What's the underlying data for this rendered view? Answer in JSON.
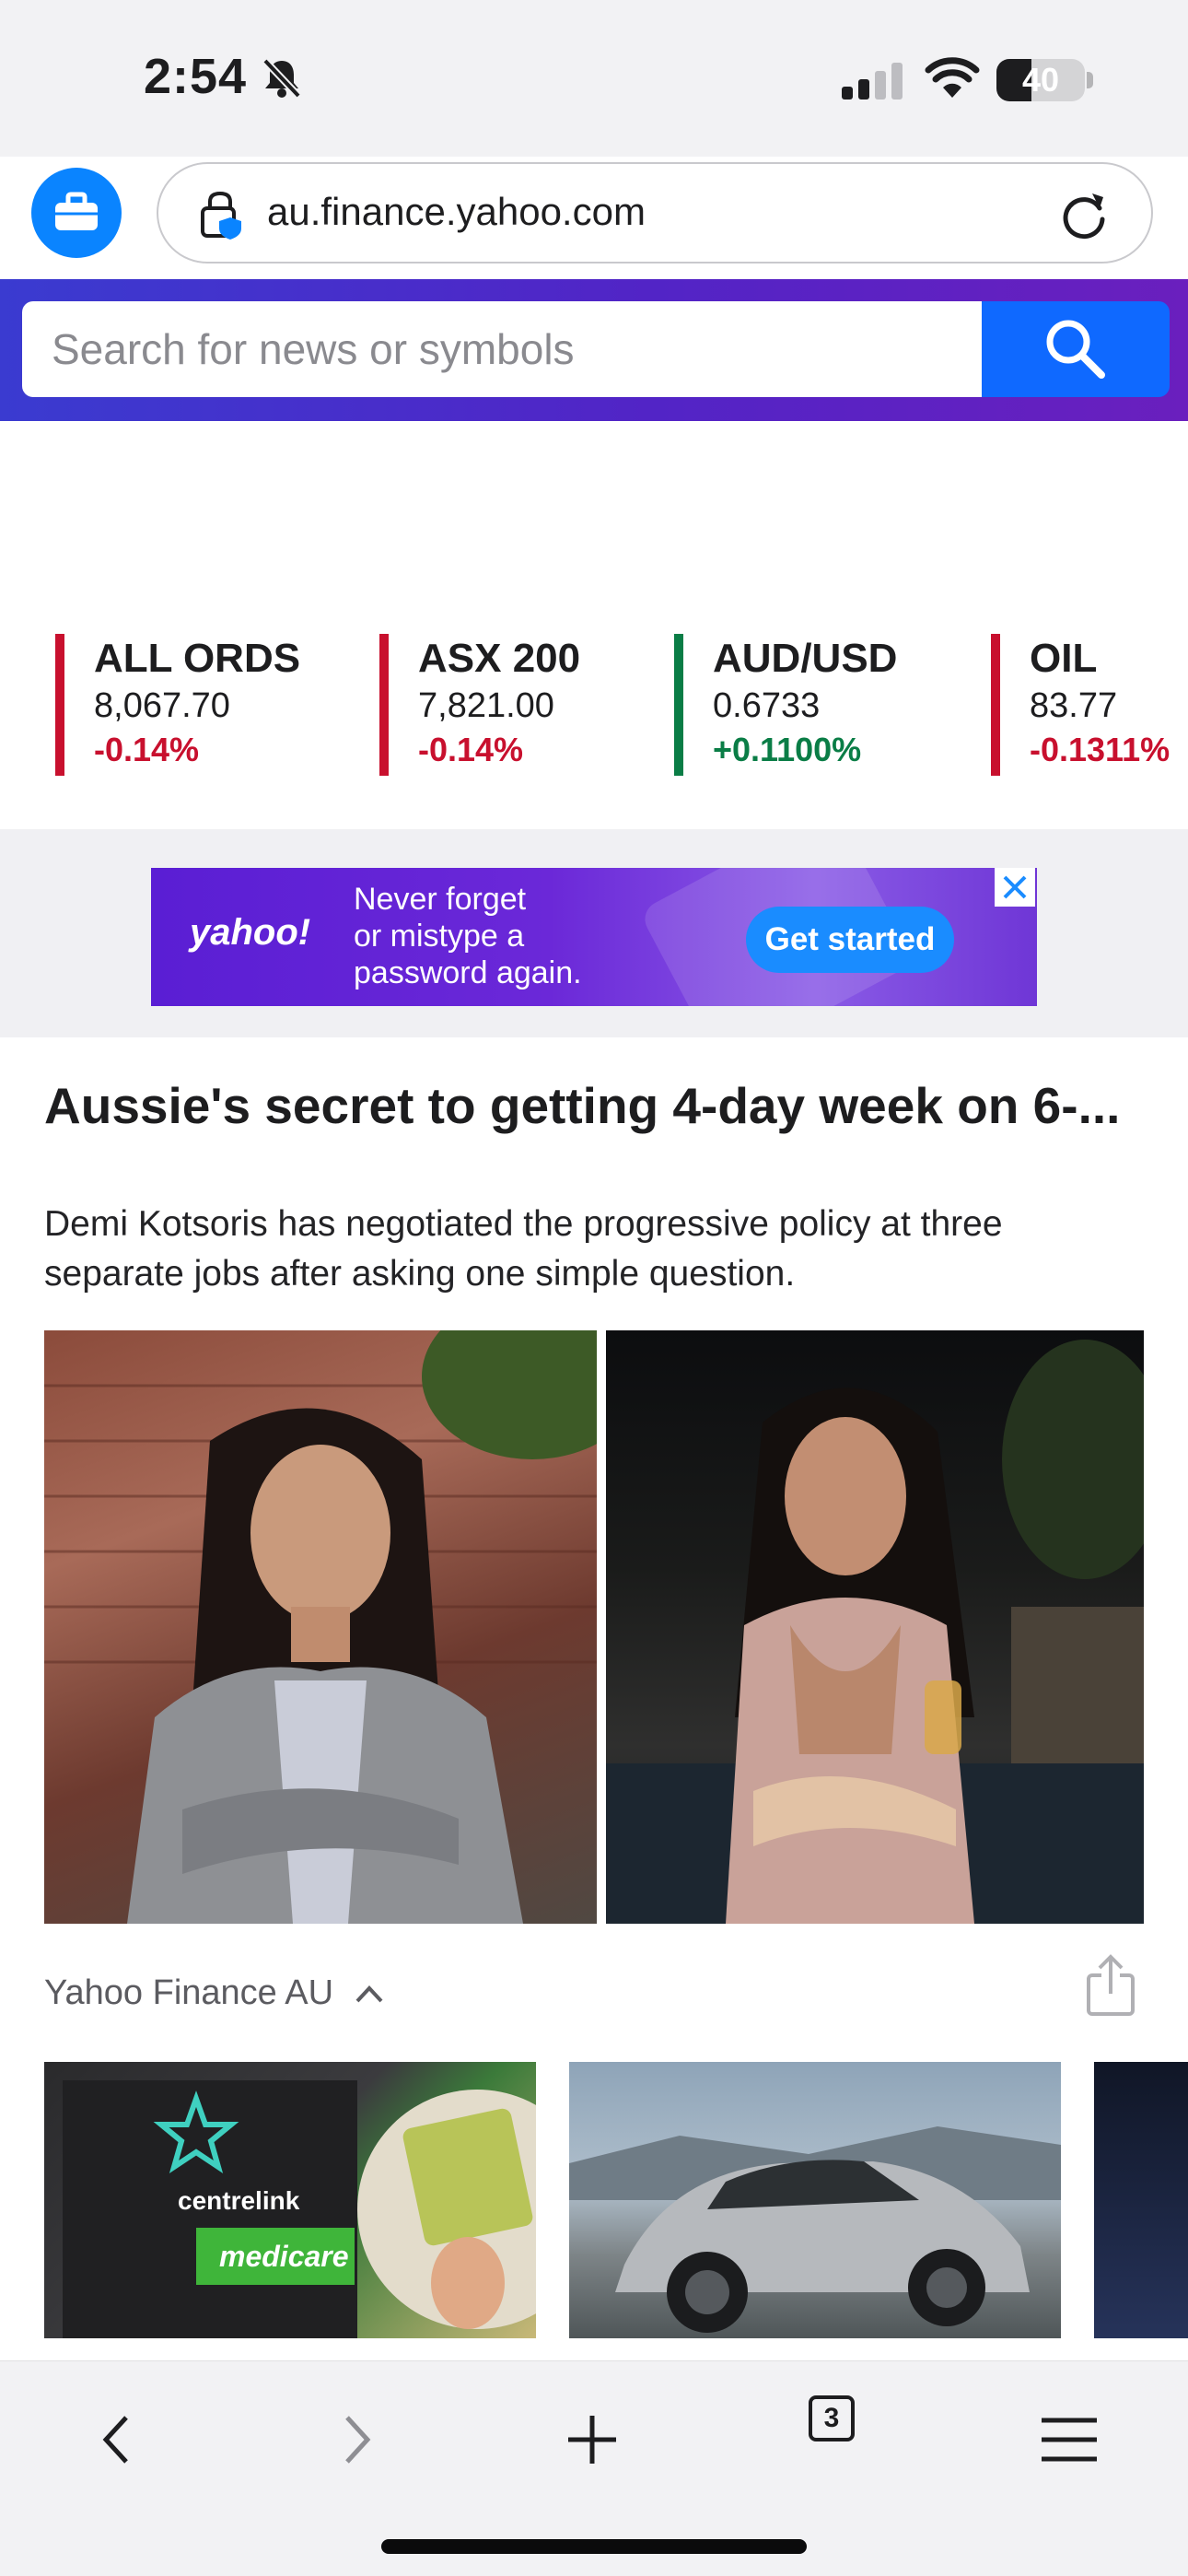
{
  "status_bar": {
    "time": "2:54",
    "battery_percent": "40",
    "battery_level": 0.4
  },
  "browser": {
    "url": "au.finance.yahoo.com",
    "tab_count": "3"
  },
  "header": {
    "search_placeholder": "Search for news or symbols"
  },
  "tickers": [
    {
      "name": "ALL ORDS",
      "price": "8,067.70",
      "change": "-0.14%",
      "direction": "down"
    },
    {
      "name": "ASX 200",
      "price": "7,821.00",
      "change": "-0.14%",
      "direction": "down"
    },
    {
      "name": "AUD/USD",
      "price": "0.6733",
      "change": "+0.1100%",
      "direction": "up"
    },
    {
      "name": "OIL",
      "price": "83.77",
      "change": "-0.1311%",
      "direction": "down"
    }
  ],
  "colors": {
    "down": "#c8102e",
    "up": "#0a7d46",
    "accent": "#0f69ff",
    "ad_purple": "#5a1ed4"
  },
  "ad": {
    "brand": "yahoo!",
    "line1": "Never forget",
    "line2": "or mistype a",
    "line3": "password again.",
    "cta": "Get started"
  },
  "article": {
    "title": "Aussie's secret to getting 4-day week on 6-...",
    "summary": "Demi Kotsoris has negotiated the progressive policy at three separate jobs after asking one simple question.",
    "source": "Yahoo Finance AU"
  },
  "thumbnail_texts": {
    "centrelink": "centrelink",
    "medicare": "medicare"
  },
  "icons": [
    "bell-slash-icon",
    "signal-icon",
    "wifi-icon",
    "briefcase-icon",
    "lock-icon",
    "reload-icon",
    "search-icon",
    "close-icon",
    "chevron-up-icon",
    "share-icon",
    "back-icon",
    "forward-icon",
    "new-tab-icon",
    "tabs-icon",
    "menu-icon"
  ]
}
